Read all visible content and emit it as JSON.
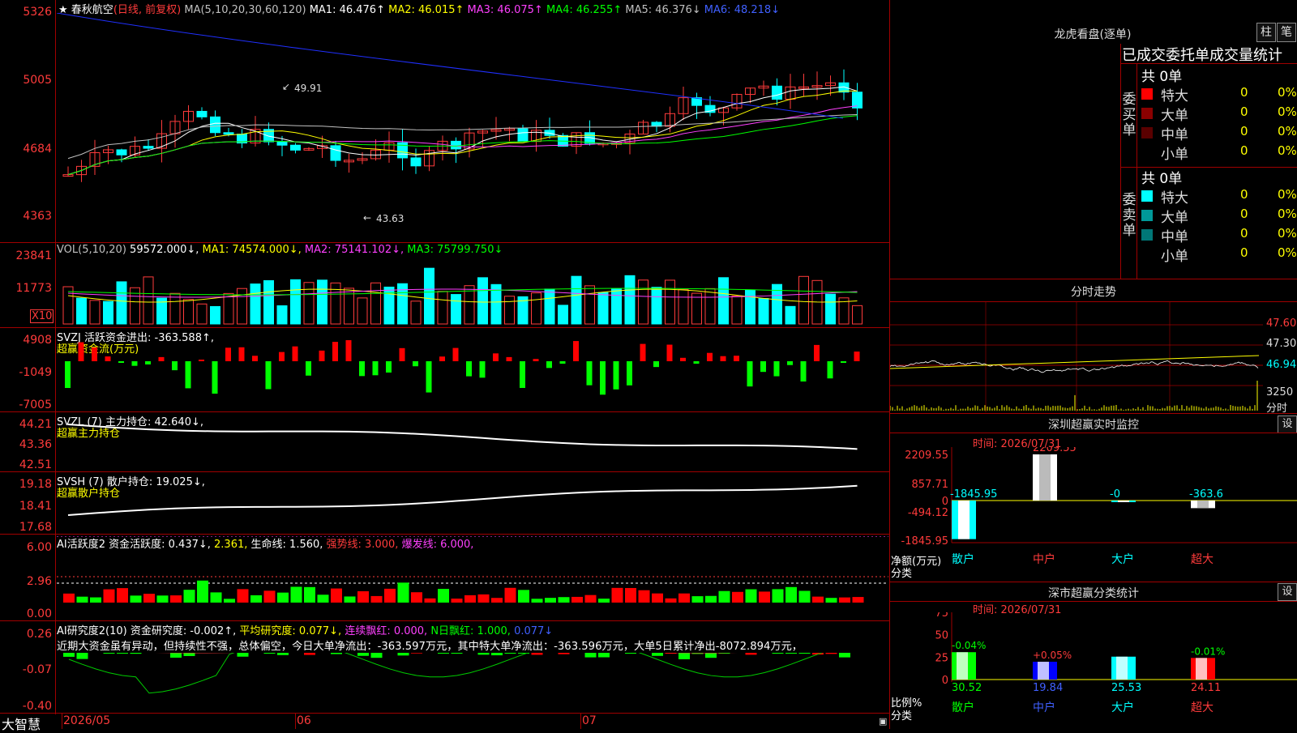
{
  "main": {
    "stock_name": "春秋航空",
    "mode": "(日线, 前复权)",
    "ma_params": "MA(5,10,20,30,60,120)",
    "ma": [
      {
        "text": "MA1: 46.476↑",
        "color": "#ffffff"
      },
      {
        "text": "MA2: 46.015↑",
        "color": "#ffff00"
      },
      {
        "text": "MA3: 46.075↑",
        "color": "#ff40ff"
      },
      {
        "text": "MA4: 46.255↑",
        "color": "#00ff00"
      },
      {
        "text": "MA5: 46.376↓",
        "color": "#c0c0c0"
      },
      {
        "text": "MA6: 48.218↓",
        "color": "#4060ff"
      }
    ],
    "y_labels": [
      "5326",
      "5005",
      "4684",
      "4363"
    ],
    "high_label": "49.91",
    "low_label": "43.63"
  },
  "vol": {
    "header": "VOL(5,10,20)",
    "value": "59572.000↓",
    "ma": [
      {
        "text": "MA1: 74574.000↓",
        "color": "#ffff00"
      },
      {
        "text": "MA2: 75141.102↓",
        "color": "#ff40ff"
      },
      {
        "text": "MA3: 75799.750↓",
        "color": "#00ff00"
      }
    ],
    "y_labels": [
      "23841",
      "11773"
    ],
    "unit": "X10"
  },
  "svzj": {
    "header": "SVZJ  活跃资金进出: -363.588↑,",
    "subtitle": "超赢资金流(万元)",
    "y_labels": [
      "4908",
      "-1049",
      "-7005"
    ]
  },
  "svzl": {
    "header": "SVZL (7) 主力持仓: 42.640↓,",
    "subtitle": "超赢主力持仓",
    "y_labels": [
      "44.21",
      "43.36",
      "42.51"
    ]
  },
  "svsh": {
    "header": "SVSH (7) 散户持仓: 19.025↓,",
    "subtitle": "超赢散户持仓",
    "y_labels": [
      "19.18",
      "18.41",
      "17.68"
    ]
  },
  "ai1": {
    "h1": "AI活跃度2 资金活跃度: 0.437↓,",
    "h2": "2.361,",
    "h3": "生命线: 1.560,",
    "h4": "强势线: 3.000,",
    "h5": "爆发线: 6.000,",
    "y_labels": [
      "6.00",
      "2.96",
      "0.00"
    ]
  },
  "ai2": {
    "h1": "AI研究度2(10) 资金研究度: -0.002↑,",
    "h2": "平均研究度: 0.077↓,",
    "h3": "连续飘红: 0.000,",
    "h4": "N日飘红: 1.000,",
    "h5": "0.077↓",
    "comment": "近期大资金虽有异动，但持续性不强，总体偏空，今日大单净流出：-363.597万元，其中特大单净流出：-363.596万元，大单5日累计净出-8072.894万元，",
    "y_labels": [
      "0.26",
      "-0.07",
      "-0.40"
    ]
  },
  "xaxis": {
    "logo": "大智慧",
    "months": [
      "2026/05",
      "06",
      "07"
    ]
  },
  "lhb": {
    "title": "龙虎看盘(逐单)",
    "btn1": "柱",
    "btn2": "笔",
    "heading": "已成交委托单成交量统计",
    "buy_label": "委买单",
    "buy_total": "共 0单",
    "sell_label": "委卖单",
    "sell_total": "共 0单",
    "buy_rows": [
      {
        "name": "特大",
        "count": "0",
        "pct": "0%",
        "color": "#ff0000"
      },
      {
        "name": "大单",
        "count": "0",
        "pct": "0%",
        "color": "#8b0000"
      },
      {
        "name": "中单",
        "count": "0",
        "pct": "0%",
        "color": "#5a0000"
      },
      {
        "name": "小单",
        "count": "0",
        "pct": "0%",
        "color": "#000000"
      }
    ],
    "sell_rows": [
      {
        "name": "特大",
        "count": "0",
        "pct": "0%",
        "color": "#00ffff"
      },
      {
        "name": "大单",
        "count": "0",
        "pct": "0%",
        "color": "#009999"
      },
      {
        "name": "中单",
        "count": "0",
        "pct": "0%",
        "color": "#007777"
      },
      {
        "name": "小单",
        "count": "0",
        "pct": "0%",
        "color": "#000000"
      }
    ]
  },
  "fenshi": {
    "title": "分时走势",
    "prices": [
      "47.60",
      "47.30",
      "46.94"
    ],
    "vol": "3250",
    "vol_unit": "分时"
  },
  "monitor": {
    "title": "深圳超赢实时监控",
    "set": "设",
    "time": "时间: 2026/07/31",
    "y_labels": [
      "2209.55",
      "857.71",
      "0",
      "-494.12",
      "-1845.95"
    ],
    "axis_title": "净额(万元)",
    "axis_sub": "分类",
    "categories": [
      "散户",
      "中户",
      "大户",
      "超大"
    ],
    "values": [
      -1845.95,
      2209.55,
      -0.0,
      -363.6
    ],
    "value_labels": [
      "-1845.95",
      "2209.55",
      "-0",
      "-363.6"
    ]
  },
  "stats": {
    "title": "深市超赢分类统计",
    "set": "设",
    "time": "时间: 2026/07/31",
    "y_labels": [
      "75",
      "50",
      "25",
      "0"
    ],
    "axis_title": "比例%",
    "axis_sub": "分类",
    "categories": [
      "散户",
      "中户",
      "大户",
      "超大"
    ],
    "values": [
      30.52,
      19.84,
      25.53,
      24.11
    ],
    "value_labels": [
      "30.52",
      "19.84",
      "25.53",
      "24.11"
    ],
    "changes": [
      "-0.04%",
      "+0.05%",
      "",
      "-0.01%"
    ]
  }
}
